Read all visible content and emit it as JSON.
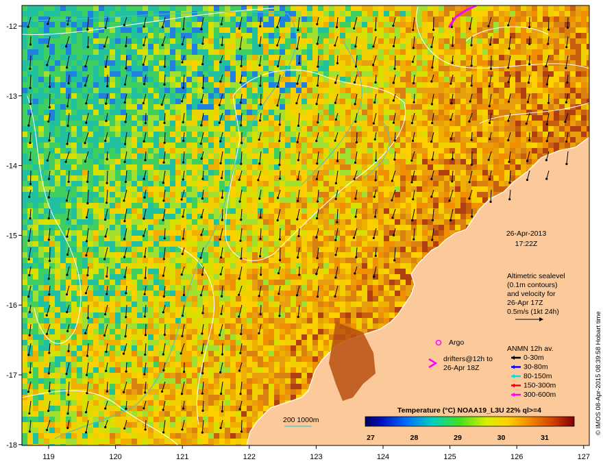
{
  "map": {
    "x_ticks": [
      "119",
      "120",
      "121",
      "122",
      "123",
      "124",
      "125",
      "126",
      "127"
    ],
    "y_ticks": [
      "-12",
      "-13",
      "-14",
      "-15",
      "-16",
      "-17",
      "-18"
    ],
    "date": "26-Apr-2013",
    "time": "17:22Z",
    "altimetry_lines": [
      "Altimetric sealevel",
      "(0.1m contours)",
      "and velocity for",
      "26-Apr 17Z",
      "0.5m/s (1kt 24h)"
    ],
    "argo_label": "Argo",
    "drifters_lines": [
      "drifters@12h to",
      "26-Apr 18Z"
    ],
    "anmn_title": "ANMN 12h av.",
    "anmn_items": [
      {
        "label": "0-30m",
        "color": "#000000"
      },
      {
        "label": "30-80m",
        "color": "#0000ff"
      },
      {
        "label": "80-150m",
        "color": "#00e0e0"
      },
      {
        "label": "150-300m",
        "color": "#ff0000"
      },
      {
        "label": "300-600m",
        "color": "#ff00ff"
      }
    ],
    "isobath_label": "200  1000m",
    "colorbar_title": "Temperature (°C) NOAA19_L3U 22% ql>=4",
    "colorbar_ticks": [
      "27",
      "28",
      "29",
      "30",
      "31"
    ],
    "credit": "© IMOS 08-Apr-2015 08:39:58 Hobart time",
    "colors": {
      "land": "#fbc99a",
      "isobath": "#40c8c8",
      "contour": "#ffffff",
      "argo": "#ff00ff"
    }
  }
}
